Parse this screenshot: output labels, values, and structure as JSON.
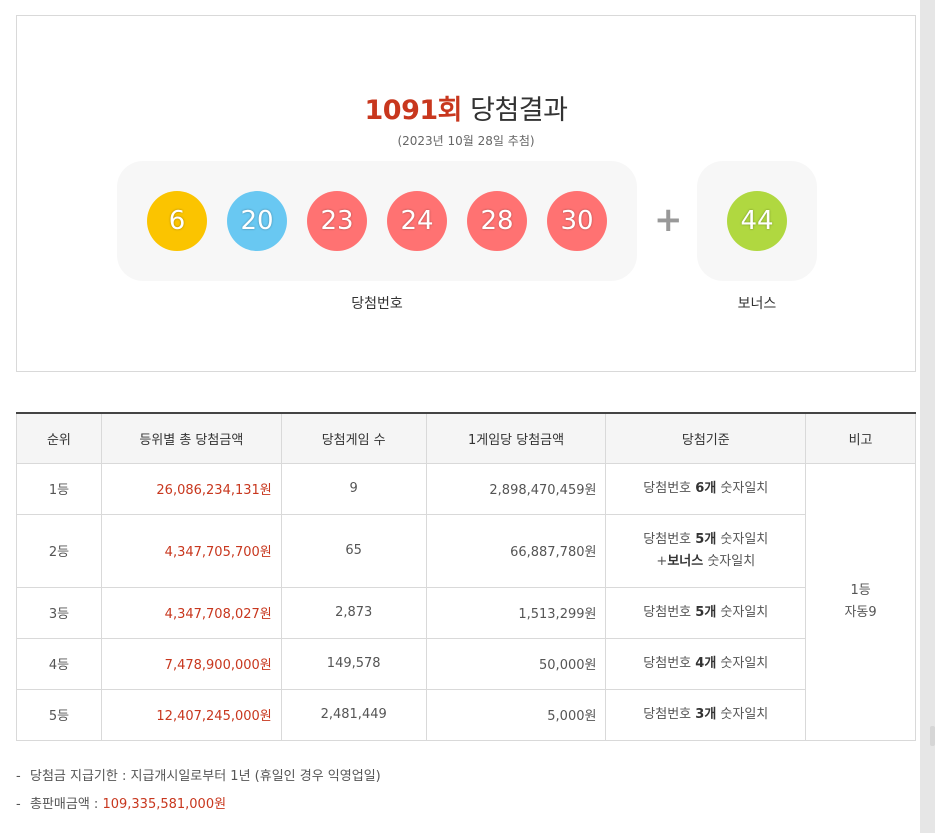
{
  "header": {
    "round": "1091회",
    "title_rest": "당첨결과",
    "draw_date": "(2023년 10월 28일 추첨)"
  },
  "winning_numbers": {
    "balls": [
      {
        "number": "6",
        "color": "#fbc400"
      },
      {
        "number": "20",
        "color": "#69c8f2"
      },
      {
        "number": "23",
        "color": "#ff7272"
      },
      {
        "number": "24",
        "color": "#ff7272"
      },
      {
        "number": "28",
        "color": "#ff7272"
      },
      {
        "number": "30",
        "color": "#ff7272"
      }
    ],
    "plus_symbol": "+",
    "bonus": {
      "number": "44",
      "color": "#b0d840"
    },
    "label_main": "당첨번호",
    "label_bonus": "보너스"
  },
  "prize_table": {
    "headers": [
      "순위",
      "등위별 총 당첨금액",
      "당첨게임 수",
      "1게임당 당첨금액",
      "당첨기준",
      "비고"
    ],
    "rows": [
      {
        "rank": "1등",
        "total": "26,086,234,131원",
        "games": "9",
        "per_game": "2,898,470,459원",
        "crit_a": "당첨번호 ",
        "crit_b": "6개",
        "crit_c": " 숫자일치"
      },
      {
        "rank": "2등",
        "total": "4,347,705,700원",
        "games": "65",
        "per_game": "66,887,780원",
        "crit_a": "당첨번호 ",
        "crit_b": "5개",
        "crit_c": " 숫자일치",
        "crit2_a": "+",
        "crit2_b": "보너스",
        "crit2_c": " 숫자일치"
      },
      {
        "rank": "3등",
        "total": "4,347,708,027원",
        "games": "2,873",
        "per_game": "1,513,299원",
        "crit_a": "당첨번호 ",
        "crit_b": "5개",
        "crit_c": " 숫자일치"
      },
      {
        "rank": "4등",
        "total": "7,478,900,000원",
        "games": "149,578",
        "per_game": "50,000원",
        "crit_a": "당첨번호 ",
        "crit_b": "4개",
        "crit_c": " 숫자일치"
      },
      {
        "rank": "5등",
        "total": "12,407,245,000원",
        "games": "2,481,449",
        "per_game": "5,000원",
        "crit_a": "당첨번호 ",
        "crit_b": "3개",
        "crit_c": " 숫자일치"
      }
    ],
    "remark_line1": "1등",
    "remark_line2": "자동9"
  },
  "notes": {
    "dash": "-",
    "deadline_label": "당첨금 지급기한 : 지급개시일로부터 1년 (휴일인 경우 익영업일)",
    "sales_label": "총판매금액 : ",
    "sales_value": "109,335,581,000원"
  }
}
